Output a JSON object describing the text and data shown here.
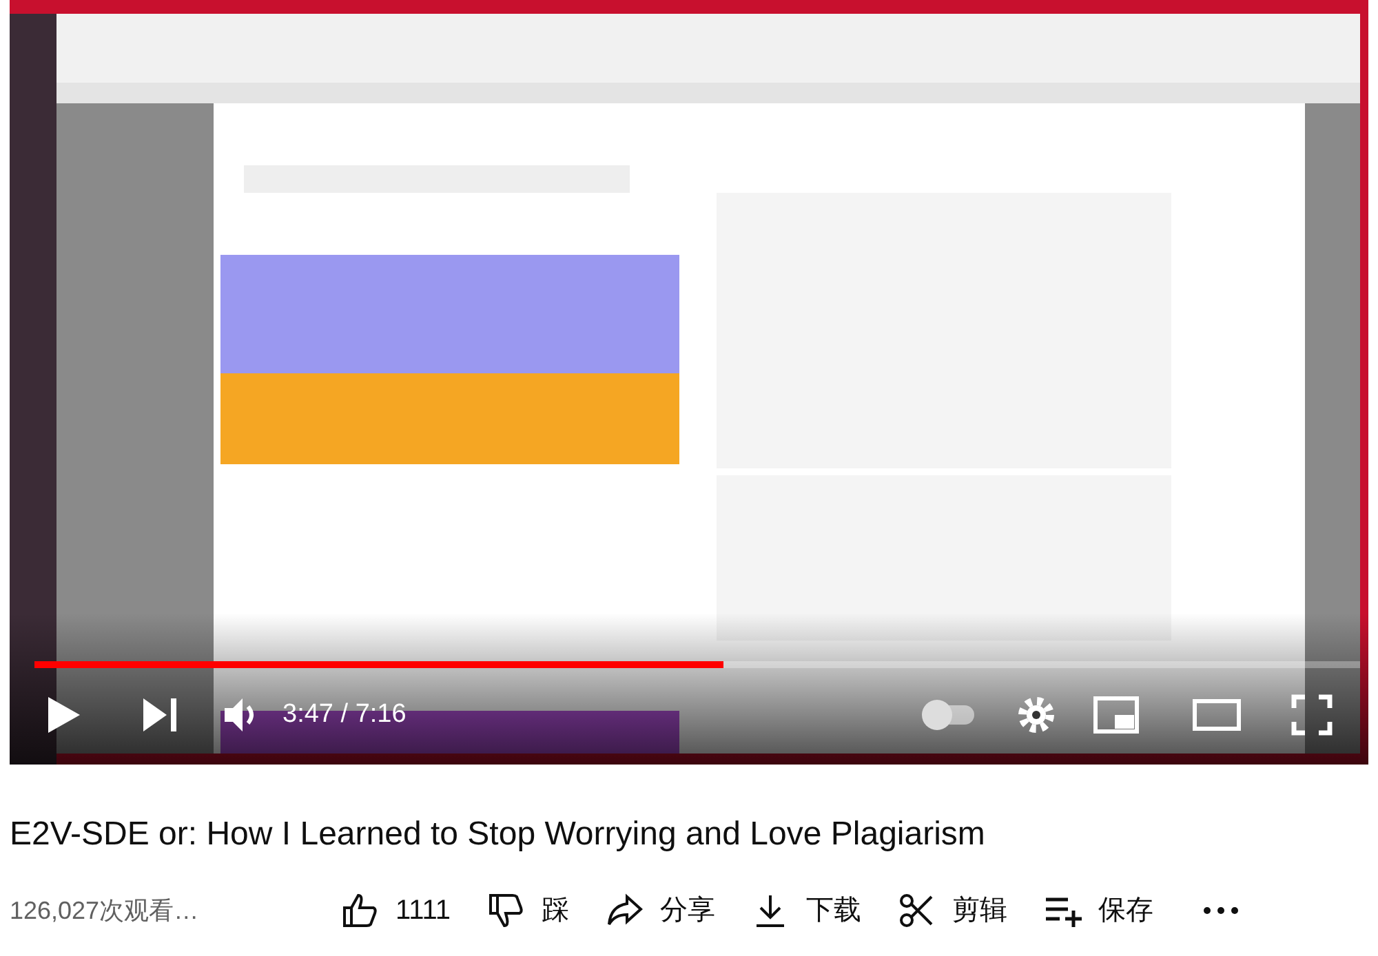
{
  "video": {
    "progress": {
      "level": 0.52
    },
    "time": "3:47 / 7:16",
    "autoplay": {
      "on": false
    }
  },
  "title": "E2V-SDE or: How I Learned to Stop Worrying and Love Plagiarism",
  "views": "126,027次观看…",
  "actions": [
    {
      "kind": "like",
      "label": "1111"
    },
    {
      "kind": "dislike",
      "label": "踩"
    },
    {
      "kind": "share",
      "label": "分享"
    },
    {
      "kind": "download",
      "label": "下载"
    },
    {
      "kind": "clip",
      "label": "剪辑"
    },
    {
      "kind": "save",
      "label": "保存"
    },
    {
      "kind": "more"
    }
  ]
}
